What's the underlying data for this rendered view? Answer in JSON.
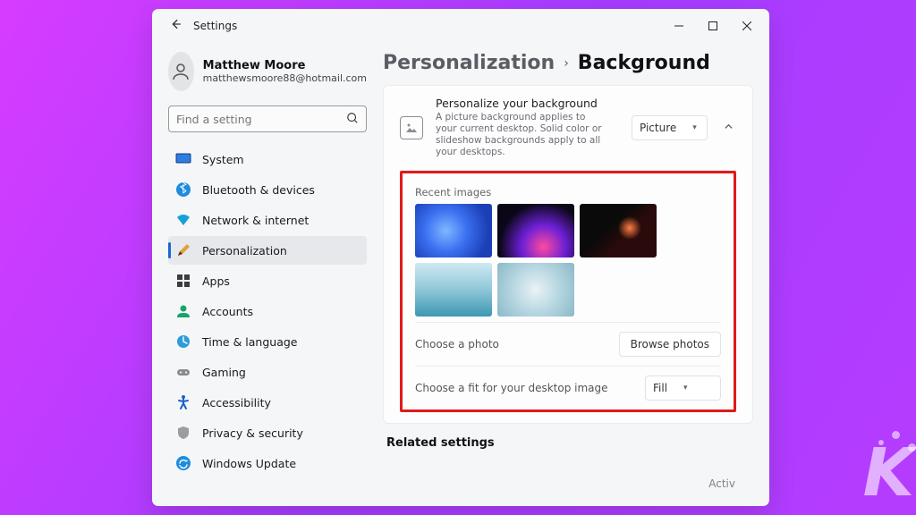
{
  "window": {
    "title": "Settings"
  },
  "user": {
    "name": "Matthew Moore",
    "email": "matthewsmoore88@hotmail.com"
  },
  "search": {
    "placeholder": "Find a setting"
  },
  "sidebar": {
    "items": [
      {
        "label": "System"
      },
      {
        "label": "Bluetooth & devices"
      },
      {
        "label": "Network & internet"
      },
      {
        "label": "Personalization"
      },
      {
        "label": "Apps"
      },
      {
        "label": "Accounts"
      },
      {
        "label": "Time & language"
      },
      {
        "label": "Gaming"
      },
      {
        "label": "Accessibility"
      },
      {
        "label": "Privacy & security"
      },
      {
        "label": "Windows Update"
      }
    ],
    "selected_index": 3
  },
  "breadcrumb": {
    "parent": "Personalization",
    "current": "Background"
  },
  "personalize": {
    "heading": "Personalize your background",
    "description": "A picture background applies to your current desktop. Solid color or slideshow backgrounds apply to all your desktops.",
    "mode_selected": "Picture"
  },
  "recent": {
    "label": "Recent images",
    "count": 5
  },
  "choose_photo": {
    "label": "Choose a photo",
    "button": "Browse photos"
  },
  "fit": {
    "label": "Choose a fit for your desktop image",
    "selected": "Fill"
  },
  "related": {
    "heading": "Related settings"
  },
  "watermark": {
    "line1": "Activ"
  }
}
